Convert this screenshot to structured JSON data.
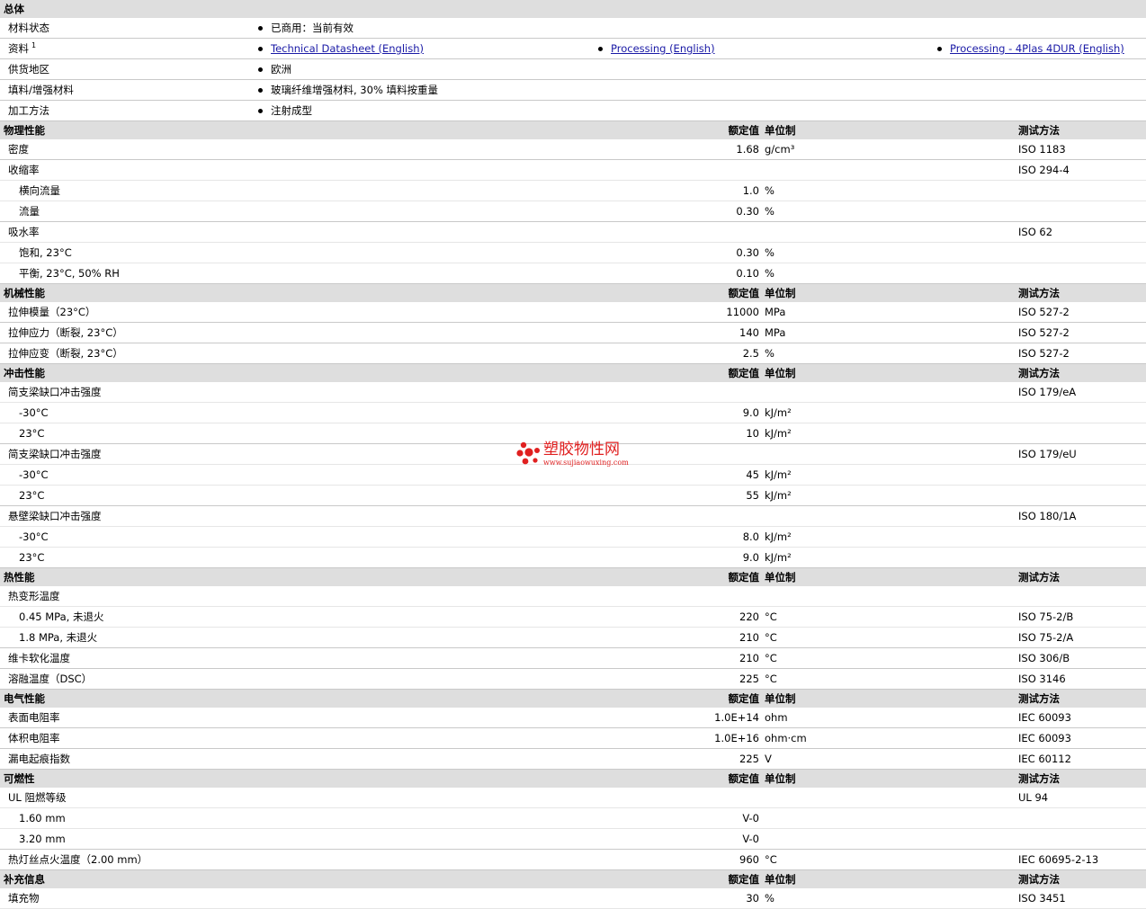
{
  "general": {
    "title": "总体",
    "rows": [
      {
        "label": "材料状态",
        "value": "已商用：当前有效"
      },
      {
        "label": "资料",
        "sup": "1",
        "links": [
          "Technical Datasheet (English)",
          "Processing (English)",
          "Processing - 4Plas 4DUR (English)"
        ]
      },
      {
        "label": "供货地区",
        "value": "欧洲"
      },
      {
        "label": "填料/增强材料",
        "value": "玻璃纤维增强材料, 30% 填料按重量"
      },
      {
        "label": "加工方法",
        "value": "注射成型"
      }
    ]
  },
  "column_headers": {
    "value": "额定值",
    "unit": "单位制",
    "test": "测试方法"
  },
  "sections": [
    {
      "title": "物理性能",
      "rows": [
        {
          "label": "密度",
          "value": "1.68",
          "unit": "g/cm³",
          "test": "ISO 1183",
          "end": true
        },
        {
          "label": "收缩率",
          "value": "",
          "unit": "",
          "test": "ISO 294-4"
        },
        {
          "label": "横向流量",
          "sub": true,
          "value": "1.0",
          "unit": "%",
          "test": ""
        },
        {
          "label": "流量",
          "sub": true,
          "value": "0.30",
          "unit": "%",
          "test": "",
          "end": true
        },
        {
          "label": "吸水率",
          "value": "",
          "unit": "",
          "test": "ISO 62"
        },
        {
          "label": "饱和, 23°C",
          "sub": true,
          "value": "0.30",
          "unit": "%",
          "test": ""
        },
        {
          "label": "平衡, 23°C, 50% RH",
          "sub": true,
          "value": "0.10",
          "unit": "%",
          "test": "",
          "end": true
        }
      ]
    },
    {
      "title": "机械性能",
      "rows": [
        {
          "label": "拉伸模量（23°C）",
          "value": "11000",
          "unit": "MPa",
          "test": "ISO 527-2",
          "end": true
        },
        {
          "label": "拉伸应力（断裂, 23°C）",
          "value": "140",
          "unit": "MPa",
          "test": "ISO 527-2",
          "end": true
        },
        {
          "label": "拉伸应变（断裂, 23°C）",
          "value": "2.5",
          "unit": "%",
          "test": "ISO 527-2",
          "end": true
        }
      ]
    },
    {
      "title": "冲击性能",
      "rows": [
        {
          "label": "简支梁缺口冲击强度",
          "value": "",
          "unit": "",
          "test": "ISO 179/eA"
        },
        {
          "label": "-30°C",
          "sub": true,
          "value": "9.0",
          "unit": "kJ/m²",
          "test": ""
        },
        {
          "label": "23°C",
          "sub": true,
          "value": "10",
          "unit": "kJ/m²",
          "test": "",
          "end": true
        },
        {
          "label": "简支梁缺口冲击强度",
          "value": "",
          "unit": "",
          "test": "ISO 179/eU"
        },
        {
          "label": "-30°C",
          "sub": true,
          "value": "45",
          "unit": "kJ/m²",
          "test": ""
        },
        {
          "label": "23°C",
          "sub": true,
          "value": "55",
          "unit": "kJ/m²",
          "test": "",
          "end": true
        },
        {
          "label": "悬壁梁缺口冲击强度",
          "value": "",
          "unit": "",
          "test": "ISO 180/1A"
        },
        {
          "label": "-30°C",
          "sub": true,
          "value": "8.0",
          "unit": "kJ/m²",
          "test": ""
        },
        {
          "label": "23°C",
          "sub": true,
          "value": "9.0",
          "unit": "kJ/m²",
          "test": "",
          "end": true
        }
      ]
    },
    {
      "title": "热性能",
      "rows": [
        {
          "label": "热变形温度",
          "value": "",
          "unit": "",
          "test": ""
        },
        {
          "label": "0.45 MPa, 未退火",
          "sub": true,
          "value": "220",
          "unit": "°C",
          "test": "ISO 75-2/B"
        },
        {
          "label": "1.8 MPa, 未退火",
          "sub": true,
          "value": "210",
          "unit": "°C",
          "test": "ISO 75-2/A",
          "end": true
        },
        {
          "label": "维卡软化温度",
          "value": "210",
          "unit": "°C",
          "test": "ISO 306/B",
          "end": true
        },
        {
          "label": "溶融温度（DSC）",
          "value": "225",
          "unit": "°C",
          "test": "ISO 3146",
          "end": true
        }
      ]
    },
    {
      "title": "电气性能",
      "rows": [
        {
          "label": "表面电阻率",
          "value": "1.0E+14",
          "unit": "ohm",
          "test": "IEC 60093",
          "end": true
        },
        {
          "label": "体积电阻率",
          "value": "1.0E+16",
          "unit": "ohm·cm",
          "test": "IEC 60093",
          "end": true
        },
        {
          "label": "漏电起痕指数",
          "value": "225",
          "unit": "V",
          "test": "IEC 60112",
          "end": true
        }
      ]
    },
    {
      "title": "可燃性",
      "rows": [
        {
          "label": "UL 阻燃等级",
          "value": "",
          "unit": "",
          "test": "UL 94"
        },
        {
          "label": "1.60 mm",
          "sub": true,
          "value": "V-0",
          "unit": "",
          "test": ""
        },
        {
          "label": "3.20 mm",
          "sub": true,
          "value": "V-0",
          "unit": "",
          "test": "",
          "end": true
        },
        {
          "label": "热灯丝点火温度（2.00 mm）",
          "value": "960",
          "unit": "°C",
          "test": "IEC 60695-2-13",
          "end": true
        }
      ]
    },
    {
      "title": "补充信息",
      "rows": [
        {
          "label": "填充物",
          "value": "30",
          "unit": "%",
          "test": "ISO 3451"
        }
      ]
    }
  ],
  "watermark": {
    "title": "塑胶物性网",
    "url": "www.sujiaowuxing.com",
    "color": "#e02020"
  }
}
